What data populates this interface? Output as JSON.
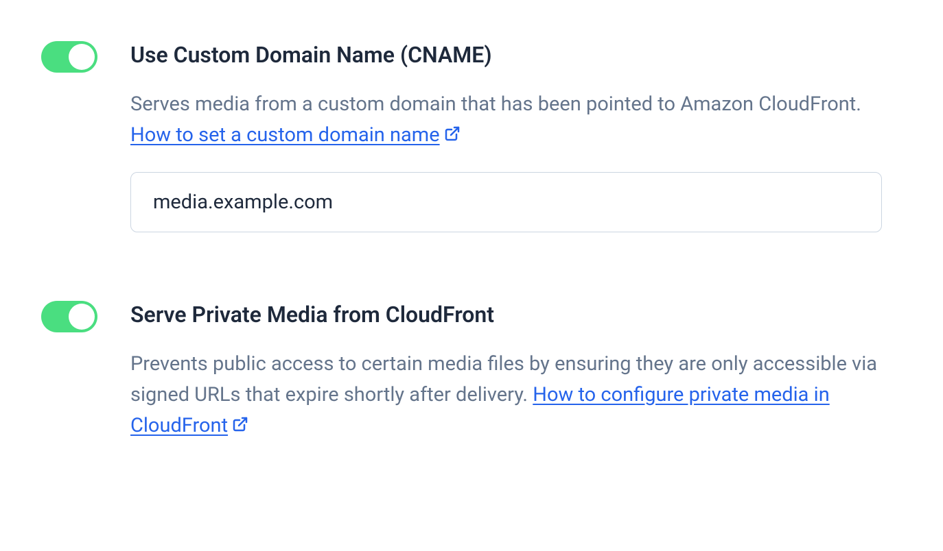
{
  "settings": {
    "customDomain": {
      "title": "Use Custom Domain Name (CNAME)",
      "descriptionPrefix": "Serves media from a custom domain that has been pointed to Amazon CloudFront. ",
      "helpLinkText": "How to set a custom domain name",
      "inputValue": "media.example.com",
      "toggleEnabled": true
    },
    "privateMedia": {
      "title": "Serve Private Media from CloudFront",
      "descriptionPrefix": "Prevents public access to certain media files by ensuring they are only accessible via signed URLs that expire shortly after delivery. ",
      "helpLinkText": "How to configure private media in CloudFront",
      "toggleEnabled": true
    }
  },
  "colors": {
    "toggleOn": "#4ade80",
    "link": "#2563eb",
    "textPrimary": "#1e293b",
    "textSecondary": "#64748b"
  }
}
